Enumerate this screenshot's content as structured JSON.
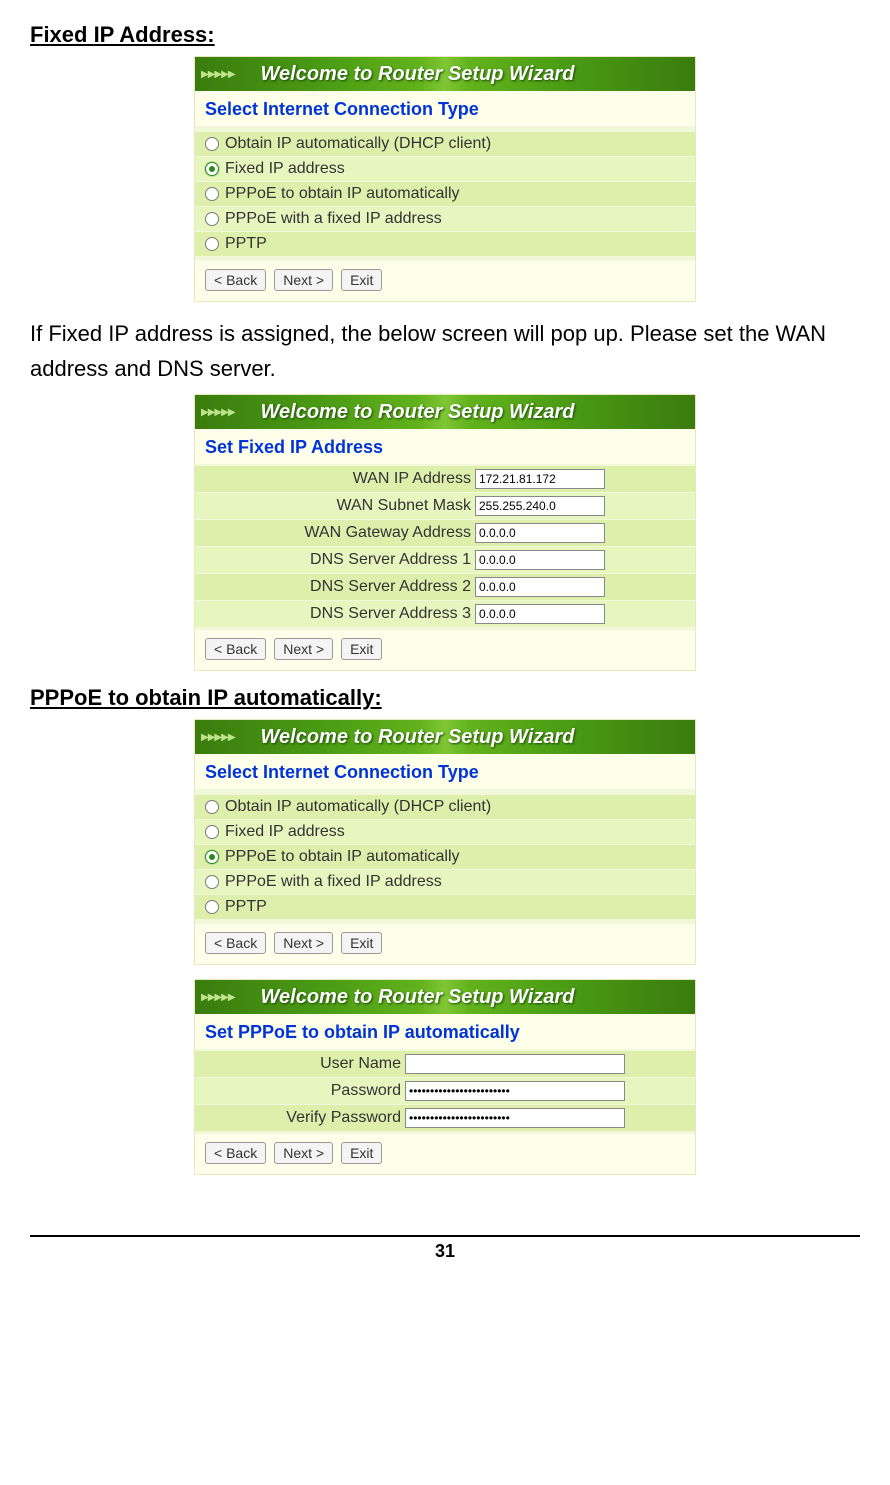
{
  "page_number": "31",
  "doc": {
    "heading1": "Fixed IP Address:",
    "para1": "If Fixed IP address is assigned, the below screen will pop up.   Please set the WAN address and DNS server.",
    "heading2": "PPPoE to obtain IP automatically:"
  },
  "banner_title": "Welcome to Router Setup Wizard",
  "buttons": {
    "back": "< Back",
    "next": "Next >",
    "exit": "Exit"
  },
  "panel1": {
    "subtitle": "Select Internet Connection Type",
    "options": [
      {
        "label": "Obtain IP automatically (DHCP client)",
        "selected": false
      },
      {
        "label": "Fixed IP address",
        "selected": true
      },
      {
        "label": "PPPoE to obtain IP automatically",
        "selected": false
      },
      {
        "label": "PPPoE with a fixed IP address",
        "selected": false
      },
      {
        "label": "PPTP",
        "selected": false
      }
    ]
  },
  "panel2": {
    "subtitle": "Set Fixed IP Address",
    "fields": [
      {
        "label": "WAN IP Address",
        "value": "172.21.81.172"
      },
      {
        "label": "WAN Subnet Mask",
        "value": "255.255.240.0"
      },
      {
        "label": "WAN Gateway Address",
        "value": "0.0.0.0"
      },
      {
        "label": "DNS Server Address 1",
        "value": "0.0.0.0"
      },
      {
        "label": "DNS Server Address 2",
        "value": "0.0.0.0"
      },
      {
        "label": "DNS Server Address 3",
        "value": "0.0.0.0"
      }
    ]
  },
  "panel3": {
    "subtitle": "Select Internet Connection Type",
    "options": [
      {
        "label": "Obtain IP automatically (DHCP client)",
        "selected": false
      },
      {
        "label": "Fixed IP address",
        "selected": false
      },
      {
        "label": "PPPoE to obtain IP automatically",
        "selected": true
      },
      {
        "label": "PPPoE with a fixed IP address",
        "selected": false
      },
      {
        "label": "PPTP",
        "selected": false
      }
    ]
  },
  "panel4": {
    "subtitle": "Set PPPoE to obtain IP automatically",
    "fields": [
      {
        "label": "User Name",
        "value": "",
        "type": "text"
      },
      {
        "label": "Password",
        "value": "••••••••••••••••••••••••",
        "type": "password"
      },
      {
        "label": "Verify Password",
        "value": "••••••••••••••••••••••••",
        "type": "password"
      }
    ]
  }
}
